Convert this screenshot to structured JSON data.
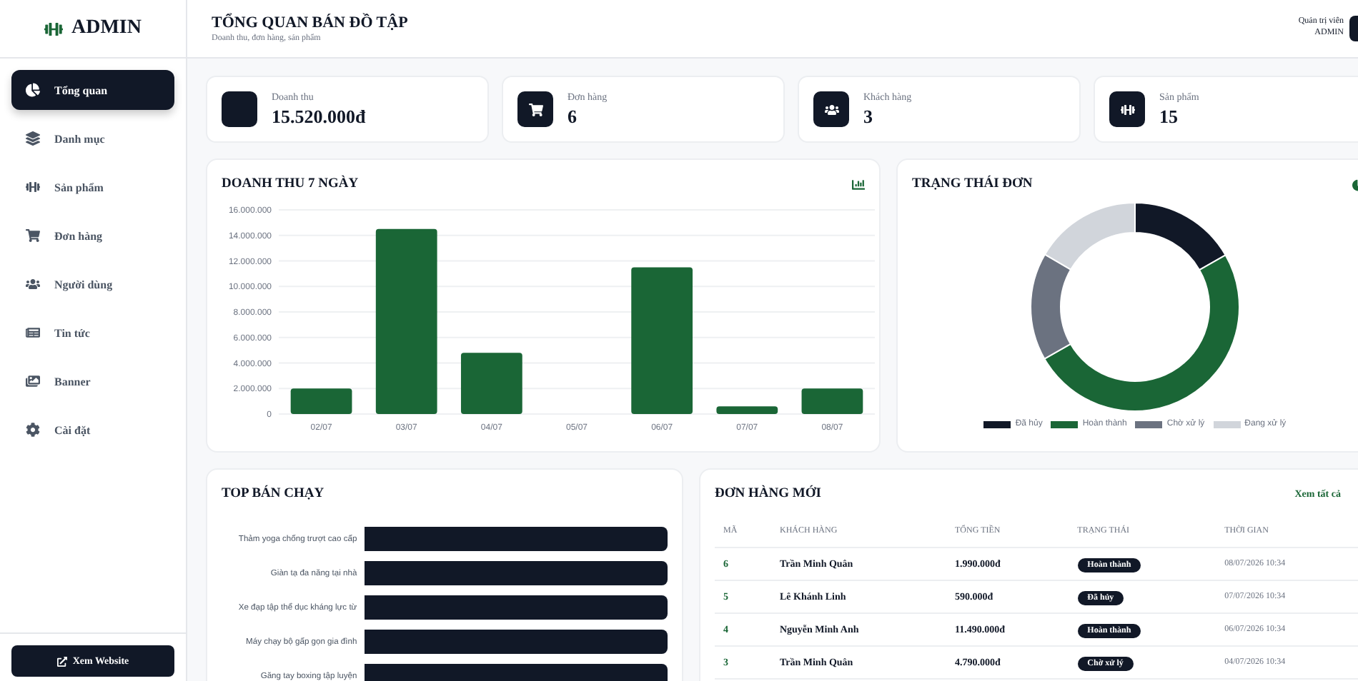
{
  "sidebar": {
    "brand": "ADMIN",
    "items": [
      {
        "label": "Tổng quan",
        "selected": true
      },
      {
        "label": "Danh mục",
        "selected": false
      },
      {
        "label": "Sản phẩm",
        "selected": false
      },
      {
        "label": "Đơn hàng",
        "selected": false
      },
      {
        "label": "Người dùng",
        "selected": false
      },
      {
        "label": "Tin tức",
        "selected": false
      },
      {
        "label": "Banner",
        "selected": false
      },
      {
        "label": "Cài đặt",
        "selected": false
      }
    ],
    "footer_button": "Xem Website"
  },
  "header": {
    "title": "TỔNG QUAN BÁN ĐỒ TẬP",
    "subtitle": "Doanh thu, đơn hàng, sản phẩm",
    "user_role": "Quản trị viên",
    "user_name": "ADMIN"
  },
  "stats": [
    {
      "label": "Doanh thu",
      "value": "15.520.000đ"
    },
    {
      "label": "Đơn hàng",
      "value": "6"
    },
    {
      "label": "Khách hàng",
      "value": "3"
    },
    {
      "label": "Sản phẩm",
      "value": "15"
    }
  ],
  "revenue_chart": {
    "title": "DOANH THU 7 NGÀY",
    "chart_data": {
      "type": "bar",
      "categories": [
        "02/07",
        "03/07",
        "04/07",
        "05/07",
        "06/07",
        "07/07",
        "08/07"
      ],
      "series": [
        {
          "color": "#1a6636",
          "values": [
            2000000,
            14500000,
            4800000,
            0,
            11500000,
            600000,
            2000000
          ]
        }
      ],
      "ylim": [
        0,
        16000000
      ],
      "grid": true,
      "yticks": [
        {
          "value": 0,
          "label": "0"
        },
        {
          "value": 2000000,
          "label": "2.000.000"
        },
        {
          "value": 4000000,
          "label": "4.000.000"
        },
        {
          "value": 6000000,
          "label": "6.000.000"
        },
        {
          "value": 8000000,
          "label": "8.000.000"
        },
        {
          "value": 10000000,
          "label": "10.000.000"
        },
        {
          "value": 12000000,
          "label": "12.000.000"
        },
        {
          "value": 14000000,
          "label": "14.000.000"
        },
        {
          "value": 16000000,
          "label": "16.000.000"
        }
      ]
    }
  },
  "status_chart": {
    "title": "TRẠNG THÁI ĐƠN",
    "chart_data": {
      "type": "donut",
      "categories": [
        "Đã hủy",
        "Hoàn thành",
        "Chờ xử lý",
        "Đang xử lý"
      ],
      "series": [
        {
          "colors": [
            "#111827",
            "#1a6636",
            "#6b7280",
            "#d1d5db"
          ],
          "values": [
            16.7,
            50,
            16.7,
            16.6
          ]
        }
      ]
    }
  },
  "top_selling": {
    "title": "TOP BÁN CHẠY",
    "items": [
      "Thảm yoga chống trượt cao cấp",
      "Giàn tạ đa năng tại nhà",
      "Xe đạp tập thể dục kháng lực từ",
      "Máy chạy bộ gấp gọn gia đình",
      "Găng tay boxing tập luyện"
    ]
  },
  "recent_orders": {
    "title": "ĐƠN HÀNG MỚI",
    "link": "Xem tất cả",
    "columns": [
      "MÃ",
      "KHÁCH HÀNG",
      "TỔNG TIỀN",
      "TRẠNG THÁI",
      "THỜI GIAN"
    ],
    "rows": [
      {
        "id": "6",
        "customer": "Trần Minh Quân",
        "total": "1.990.000đ",
        "status": "Hoàn thành",
        "time": "08/07/2026 10:34"
      },
      {
        "id": "5",
        "customer": "Lê Khánh Linh",
        "total": "590.000đ",
        "status": "Đã hủy",
        "time": "07/07/2026 10:34"
      },
      {
        "id": "4",
        "customer": "Nguyễn Minh Anh",
        "total": "11.490.000đ",
        "status": "Hoàn thành",
        "time": "06/07/2026 10:34"
      },
      {
        "id": "3",
        "customer": "Trần Minh Quân",
        "total": "4.790.000đ",
        "status": "Chờ xử lý",
        "time": "04/07/2026 10:34"
      }
    ]
  }
}
